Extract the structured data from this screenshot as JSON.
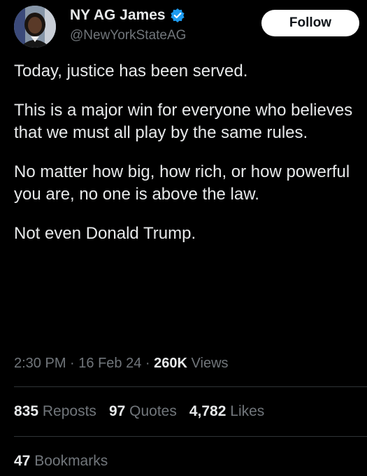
{
  "header": {
    "display_name": "NY AG James",
    "handle": "@NewYorkStateAG",
    "follow_label": "Follow",
    "verified_icon": "verified-badge-icon",
    "verified_color": "#1d9bf0"
  },
  "tweet": {
    "paragraphs": [
      "Today, justice has been served.",
      "This is a major win for everyone who believes that we must all play by the same rules.",
      "No matter how big, how rich, or how powerful you are, no one is above the law.",
      "Not even Donald Trump."
    ]
  },
  "meta": {
    "time": "2:30 PM",
    "date": "16 Feb 24",
    "separator": "·",
    "views_count": "260K",
    "views_label": "Views"
  },
  "stats": {
    "reposts_count": "835",
    "reposts_label": "Reposts",
    "quotes_count": "97",
    "quotes_label": "Quotes",
    "likes_count": "4,782",
    "likes_label": "Likes",
    "bookmarks_count": "47",
    "bookmarks_label": "Bookmarks"
  }
}
